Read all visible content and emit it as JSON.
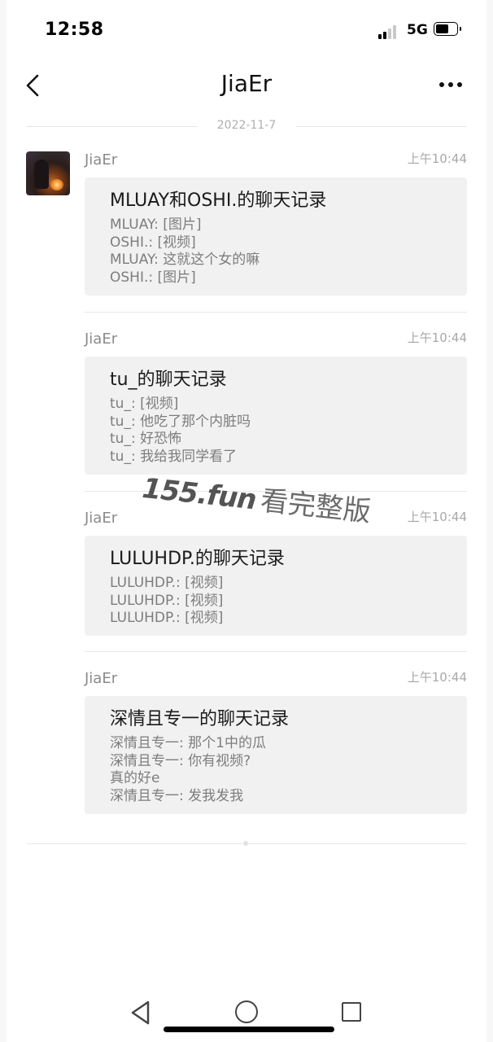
{
  "status_bar": {
    "time": "12:58",
    "network": "5G"
  },
  "nav": {
    "title": "JiaEr"
  },
  "date_separator": "2022-11-7",
  "watermark": {
    "site": "155.fun",
    "cta": "看完整版"
  },
  "messages": [
    {
      "sender": "JiaEr",
      "time": "上午10:44",
      "card": {
        "title": "MLUAY和OSHI.的聊天记录",
        "lines": [
          "MLUAY: [图片]",
          "OSHI.: [视频]",
          "MLUAY: 这就这个女的嘛",
          "OSHI.: [图片]"
        ]
      }
    },
    {
      "sender": "JiaEr",
      "time": "上午10:44",
      "card": {
        "title": "tu_的聊天记录",
        "lines": [
          "tu_: [视频]",
          "tu_: 他吃了那个内脏吗",
          "tu_: 好恐怖",
          "tu_: 我给我同学看了"
        ]
      }
    },
    {
      "sender": "JiaEr",
      "time": "上午10:44",
      "card": {
        "title": "LULUHDP.的聊天记录",
        "lines": [
          "LULUHDP.: [视频]",
          "LULUHDP.: [视频]",
          "LULUHDP.: [视频]"
        ]
      }
    },
    {
      "sender": "JiaEr",
      "time": "上午10:44",
      "card": {
        "title": "深情且专一的聊天记录",
        "lines": [
          "深情且专一: 那个1中的瓜",
          "深情且专一: 你有视频?",
          "真的好e",
          "深情且专一: 发我发我"
        ]
      }
    }
  ],
  "icons": {
    "back": "chevron-left-icon",
    "more": "more-dots-icon",
    "signal": "signal-icon",
    "battery": "battery-icon",
    "nav_back": "triangle-back-icon",
    "nav_home": "circle-home-icon",
    "nav_recent": "square-recent-icon"
  }
}
